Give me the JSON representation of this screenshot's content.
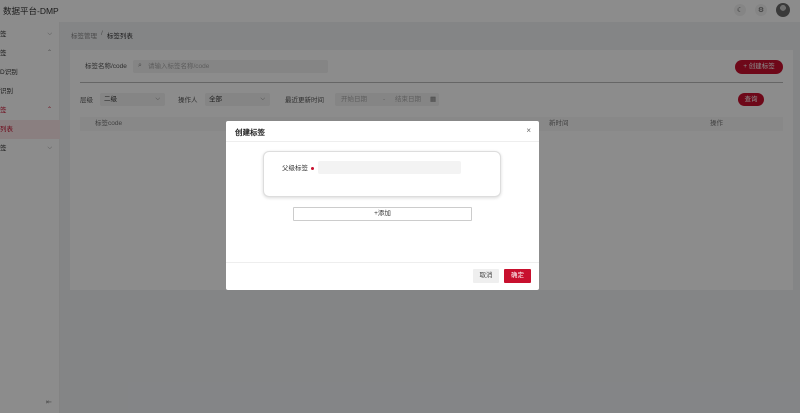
{
  "app": {
    "title": "数据平台-DMP"
  },
  "header": {
    "icons": [
      "moon-icon",
      "gear-icon",
      "avatar"
    ]
  },
  "sidebar": {
    "items": [
      {
        "label": "签",
        "expanded": false
      },
      {
        "label": "签",
        "expanded": true
      },
      {
        "label": "D识别"
      },
      {
        "label": "识别"
      },
      {
        "label": "签",
        "expanded": true,
        "active": true
      },
      {
        "label": "列表",
        "selected": true
      },
      {
        "label": "签",
        "expanded": false
      }
    ],
    "collapse_icon": "collapse-icon"
  },
  "breadcrumb": {
    "parent": "标签管理",
    "separator": "/",
    "current": "标签列表"
  },
  "filters": {
    "search_label": "标签名称/code",
    "search_placeholder": "请输入标签名称/code",
    "create_button": "+ 创建标签",
    "level_label": "层级",
    "level_value": "二级",
    "operator_label": "操作人",
    "operator_value": "全部",
    "updated_label": "最近更新时间",
    "start_placeholder": "开始日期",
    "range_sep": "-",
    "end_placeholder": "结束日期",
    "query_button": "查询"
  },
  "table": {
    "columns": [
      "标签code",
      "新时间",
      "操作"
    ]
  },
  "modal": {
    "title": "创建标签",
    "close": "×",
    "parent_label": "父级标签",
    "add_button": "+添加",
    "cancel": "取消",
    "ok": "确定"
  },
  "colors": {
    "accent": "#c8102e",
    "overlay": "rgba(0,0,0,0.45)"
  }
}
